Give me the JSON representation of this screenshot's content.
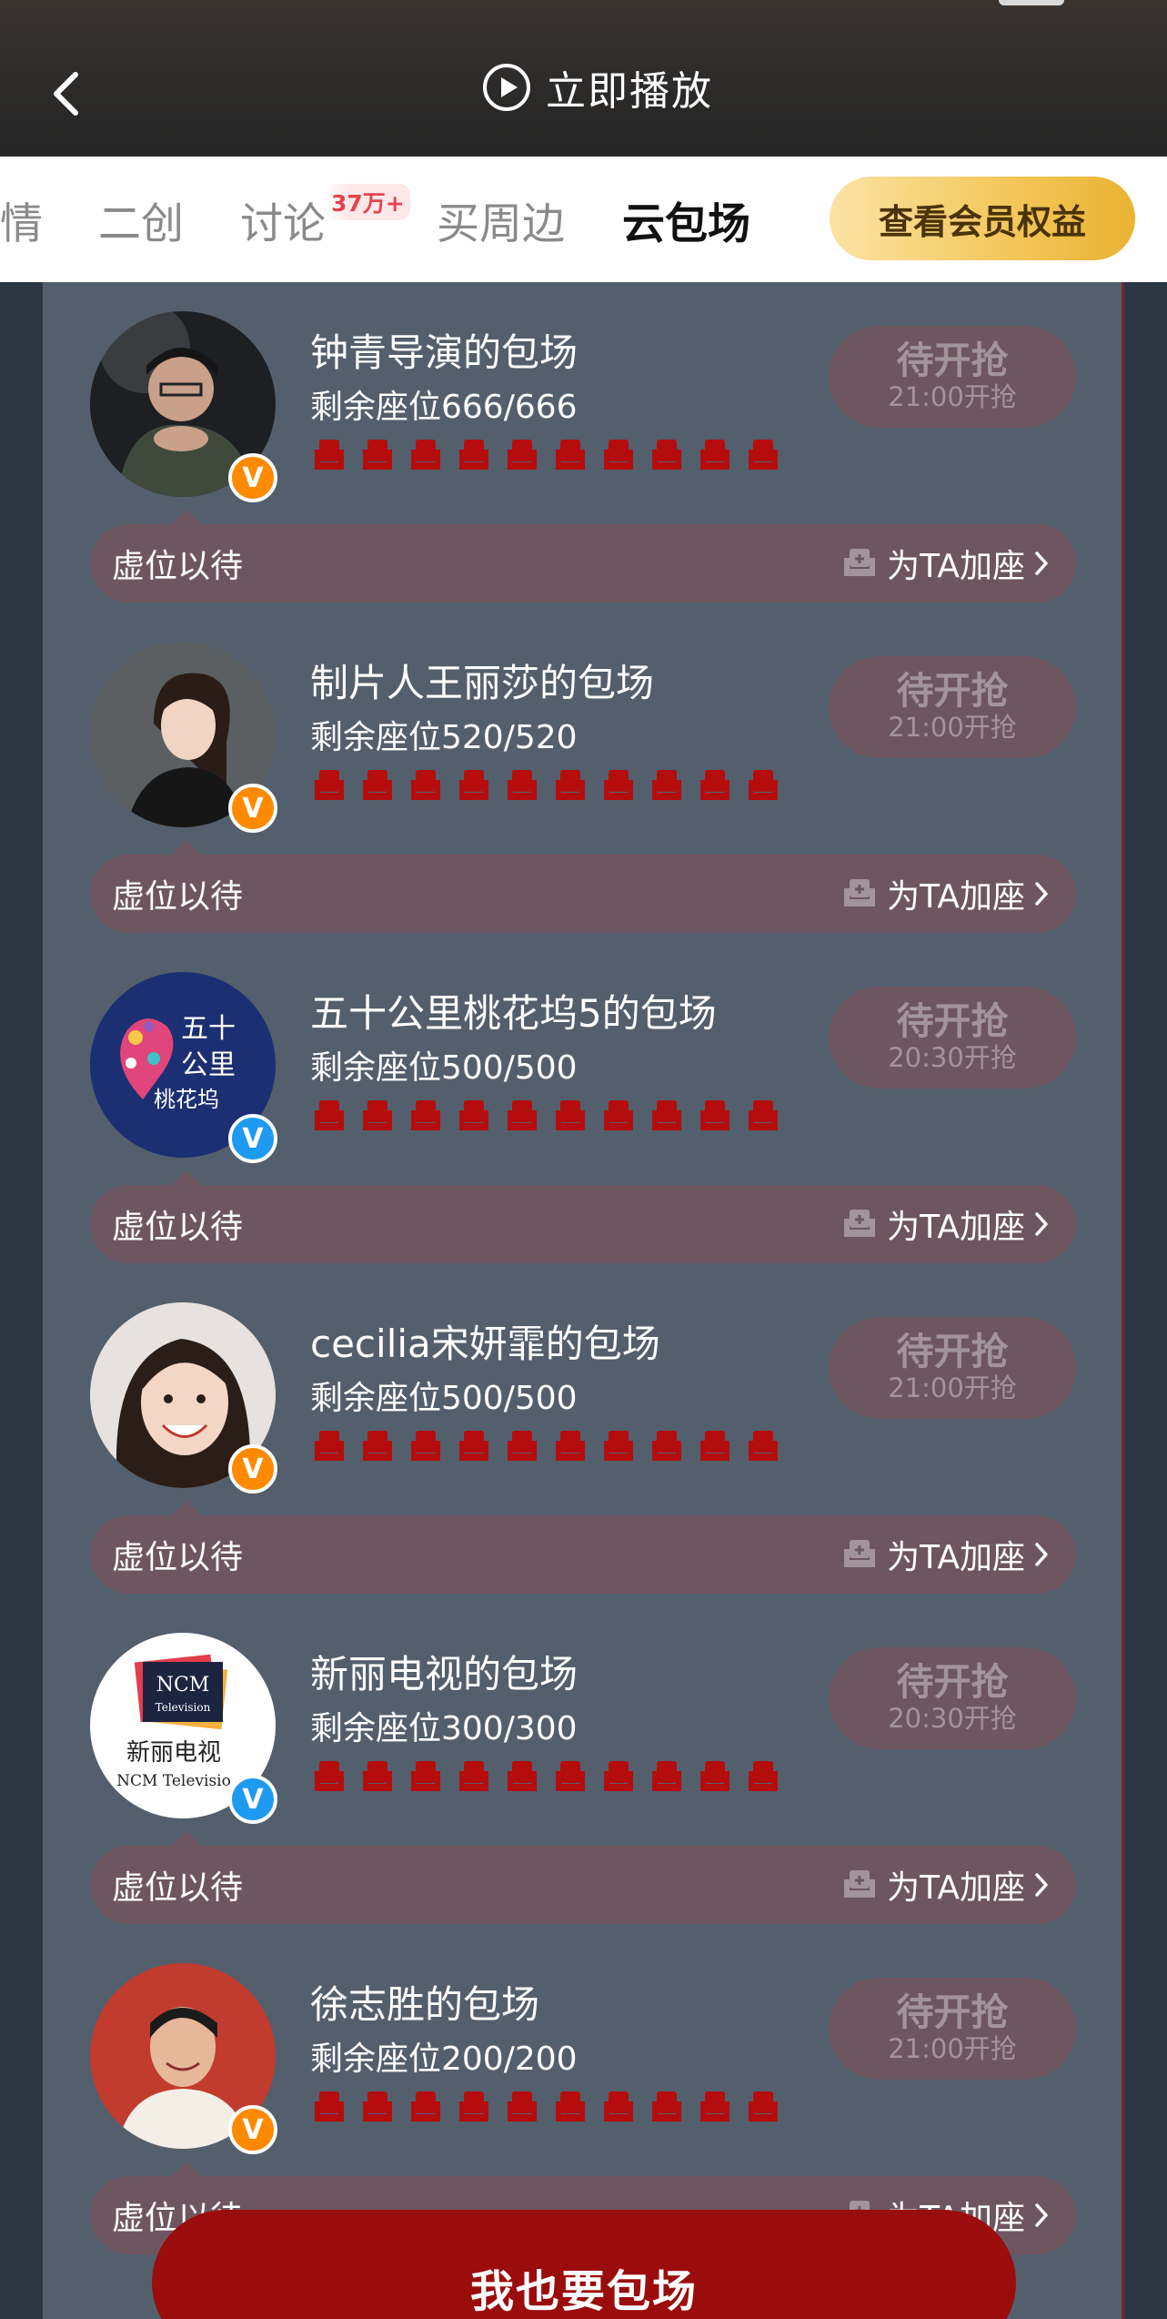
{
  "header": {
    "play_label": "立即播放"
  },
  "tabs": [
    {
      "label": "情",
      "active": false
    },
    {
      "label": "二创",
      "active": false
    },
    {
      "label": "讨论",
      "active": false,
      "badge": "37万+"
    },
    {
      "label": "买周边",
      "active": false
    },
    {
      "label": "云包场",
      "active": true
    }
  ],
  "vip_button": "查看会员权益",
  "cards": [
    {
      "title": "钟青导演的包场",
      "seats": "剩余座位666/666",
      "status": "待开抢",
      "time": "21:00开抢",
      "wait": "虚位以待",
      "add_seat": "为TA加座",
      "verify": "orange",
      "avatar_icon": "person-in-dark-avatar"
    },
    {
      "title": "制片人王丽莎的包场",
      "seats": "剩余座位520/520",
      "status": "待开抢",
      "time": "21:00开抢",
      "wait": "虚位以待",
      "add_seat": "为TA加座",
      "verify": "orange",
      "avatar_icon": "woman-portrait-avatar"
    },
    {
      "title": "五十公里桃花坞5的包场",
      "seats": "剩余座位500/500",
      "status": "待开抢",
      "time": "20:30开抢",
      "wait": "虚位以待",
      "add_seat": "为TA加座",
      "verify": "blue",
      "avatar_icon": "show-logo-avatar",
      "avatar_text": [
        "五十",
        "公里",
        "桃花坞"
      ]
    },
    {
      "title": "cecilia宋妍霏的包场",
      "seats": "剩余座位500/500",
      "status": "待开抢",
      "time": "21:00开抢",
      "wait": "虚位以待",
      "add_seat": "为TA加座",
      "verify": "orange",
      "avatar_icon": "smiling-woman-avatar"
    },
    {
      "title": "新丽电视的包场",
      "seats": "剩余座位300/300",
      "status": "待开抢",
      "time": "20:30开抢",
      "wait": "虚位以待",
      "add_seat": "为TA加座",
      "verify": "blue",
      "avatar_icon": "company-logo-avatar",
      "avatar_text": [
        "NCM",
        "Television",
        "新丽电视",
        "NCM Televisio"
      ]
    },
    {
      "title": "徐志胜的包场",
      "seats": "剩余座位200/200",
      "status": "待开抢",
      "time": "21:00开抢",
      "wait": "虚位以待",
      "add_seat": "为TA加座",
      "verify": "orange",
      "avatar_icon": "man-portrait-avatar"
    }
  ],
  "cta_label": "我也要包场",
  "colors": {
    "accent_red": "#9b0c0c",
    "seat_red": "#b50d0d",
    "panel": "#535f6d",
    "pill": "#6e5660",
    "vip_gold": "#f3c95e"
  }
}
